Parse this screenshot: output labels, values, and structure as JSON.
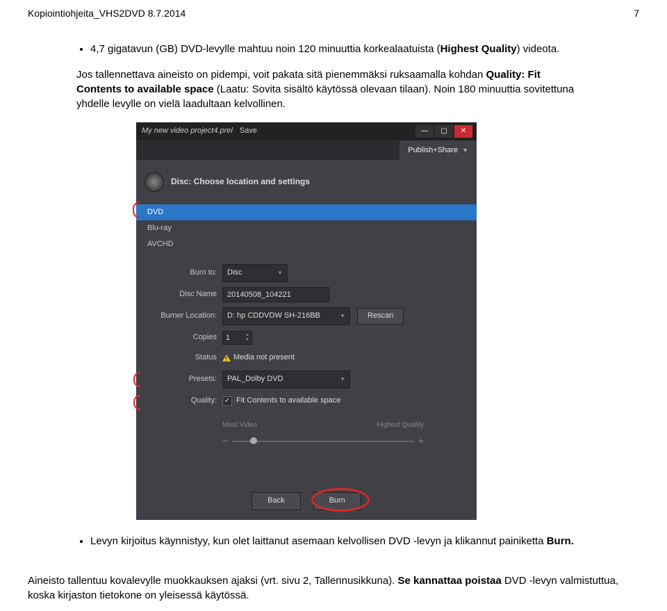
{
  "page": {
    "header_left": "Kopiointiohjeita_VHS2DVD 8.7.2014",
    "header_right": "7",
    "bullet1_a": "4,7 gigatavun (GB) DVD-levylle mahtuu noin 120 minuuttia korkealaatuista (",
    "bullet1_b": "Highest Quality",
    "bullet1_c": ") videota.",
    "para2_a": "Jos tallennettava aineisto on pidempi, voit pakata sitä pienemmäksi ruksaamalla kohdan ",
    "para2_b": "Quality: Fit Contents to available space",
    "para2_c": " (Laatu: Sovita sisältö käytössä olevaan tilaan). Noin 180 minuuttia sovitettuna yhdelle levylle on vielä laadultaan kelvollinen.",
    "bullet3_a": "Levyn kirjoitus käynnistyy, kun olet laittanut asemaan kelvollisen DVD -levyn ja klikannut painiketta ",
    "bullet3_b": "Burn.",
    "body1_a": "Aineisto tallentuu kovalevylle muokkauksen ajaksi (vrt. sivu 2, Tallennusikkuna). ",
    "body1_b": "Se kannattaa poistaa",
    "body1_c": " DVD -levyn valmistuttua, koska kirjaston tietokone on yleisessä käytössä."
  },
  "app": {
    "project_name": "My new video project4.prel",
    "save": "Save",
    "tab_publish": "Publish+Share",
    "disc_title": "Disc: Choose location and settings",
    "formats": [
      {
        "name": "DVD",
        "selected": true
      },
      {
        "name": "Blu-ray",
        "selected": false
      },
      {
        "name": "AVCHD",
        "selected": false
      }
    ],
    "labels": {
      "burn_to": "Burn to:",
      "disc_name": "Disc Name",
      "burner_location": "Burner Location:",
      "copies": "Copies",
      "status": "Status",
      "presets": "Presets:",
      "quality": "Quality:"
    },
    "values": {
      "burn_to": "Disc",
      "disc_name": "20140508_104221",
      "burner_location": "D: hp CDDVDW SH-216BB",
      "rescan": "Rescan",
      "copies": "1",
      "status": "Media not present",
      "preset": "PAL_Dolby DVD",
      "quality_checkbox": "Fit Contents to available space",
      "most_video": "Most Video",
      "highest_quality": "Highest Quality"
    },
    "buttons": {
      "back": "Back",
      "burn": "Burn"
    }
  }
}
